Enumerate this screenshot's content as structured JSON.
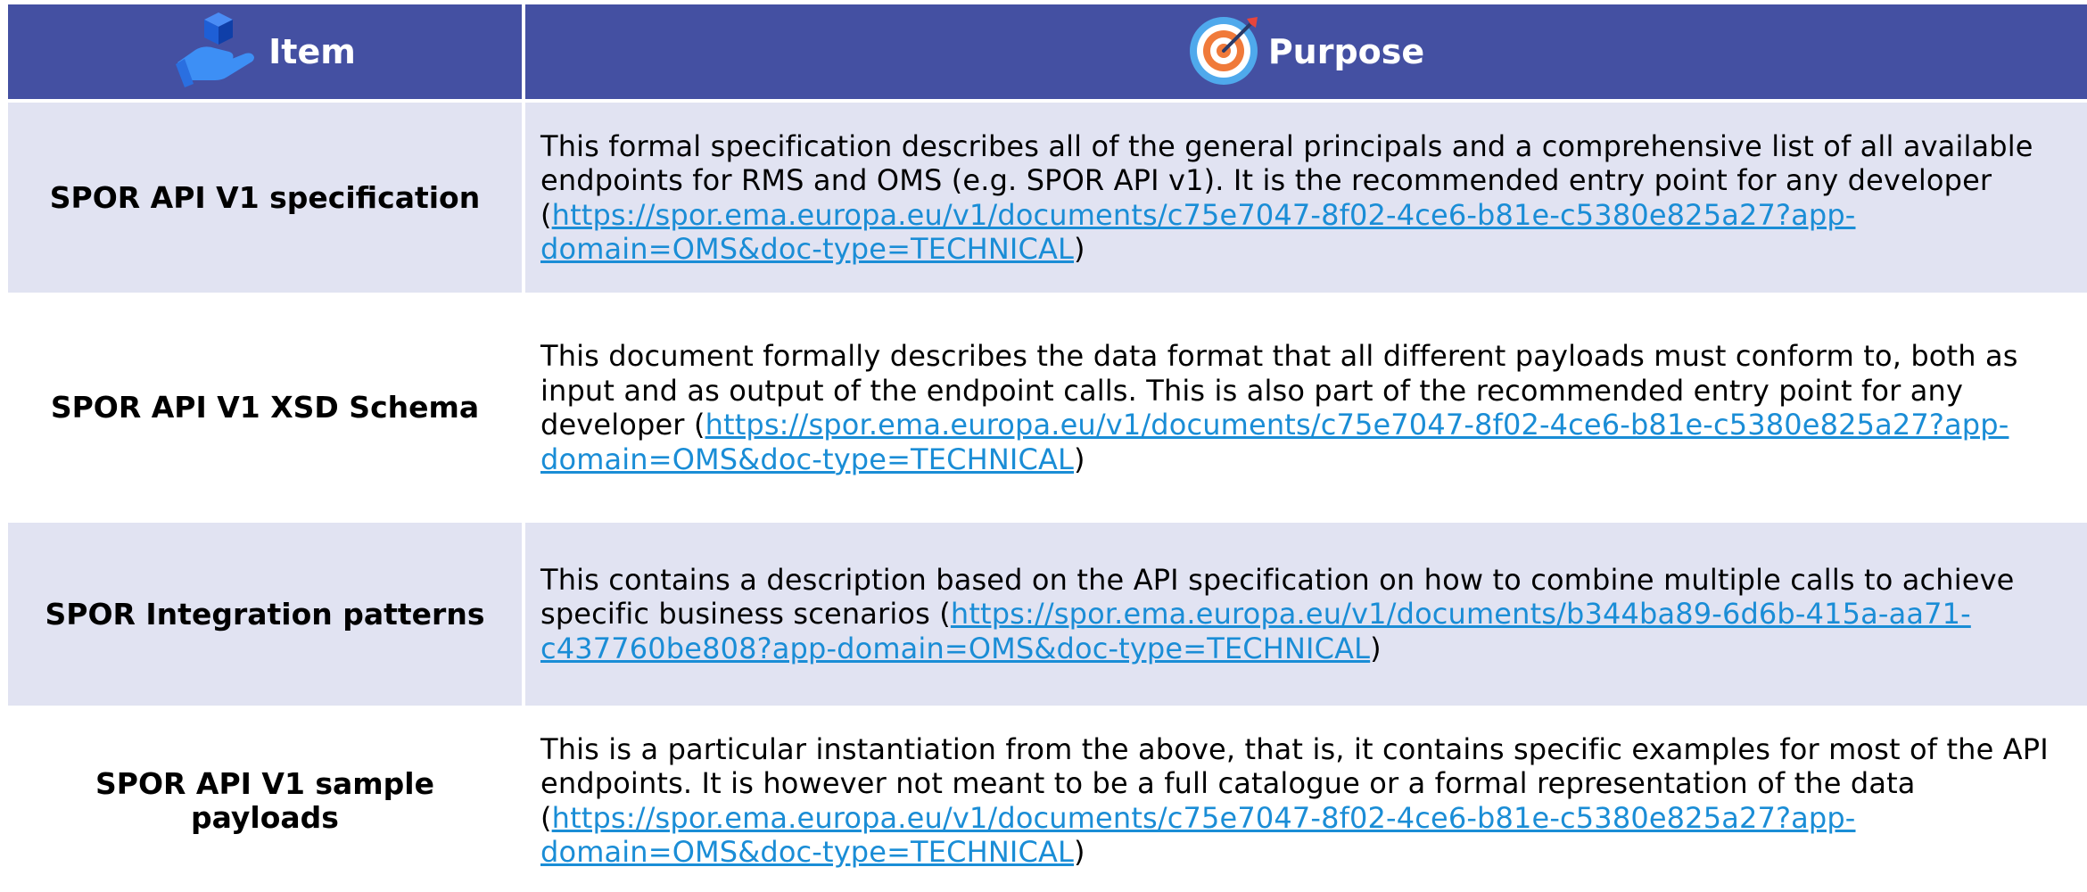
{
  "header": {
    "item_label": "Item",
    "purpose_label": "Purpose",
    "item_icon": "hand-holding-cube-icon",
    "purpose_icon": "target-dart-icon",
    "background_color": "#4450a2"
  },
  "rows": [
    {
      "item": "SPOR API V1 specification",
      "description": "This formal specification describes all of the general principals and a comprehensive list of all available endpoints for RMS and OMS (e.g. SPOR API v1). It is the recommended entry point for any developer",
      "link_open": "(",
      "link": "https://spor.ema.europa.eu/v1/documents/c75e7047-8f02-4ce6-b81e-c5380e825a27?app-domain=OMS&doc-type=TECHNICAL",
      "link_close": ")"
    },
    {
      "item": "SPOR API V1 XSD Schema",
      "description": "This document formally describes the data format that all different payloads must conform to, both as input and as output of the endpoint calls. This is also part of the recommended entry point for any developer",
      "link_open": "(",
      "link": "https://spor.ema.europa.eu/v1/documents/c75e7047-8f02-4ce6-b81e-c5380e825a27?app-domain=OMS&doc-type=TECHNICAL",
      "link_close": ")"
    },
    {
      "item": "SPOR Integration patterns",
      "description": "This contains a description based on the API specification on how to combine multiple calls to achieve specific business scenarios",
      "link_open": "(",
      "link": "https://spor.ema.europa.eu/v1/documents/b344ba89-6d6b-415a-aa71-c437760be808?app-domain=OMS&doc-type=TECHNICAL",
      "link_close": ")"
    },
    {
      "item": "SPOR API V1 sample payloads",
      "description": "This is a particular instantiation from the above, that is, it contains specific examples for most of the API endpoints. It is however not meant to be a full catalogue or a formal representation of the data",
      "link_open": "(",
      "link": "https://spor.ema.europa.eu/v1/documents/c75e7047-8f02-4ce6-b81e-c5380e825a27?app-domain=OMS&doc-type=TECHNICAL",
      "link_close": ")"
    }
  ],
  "colors": {
    "row_shade": "#e1e3f2",
    "link": "#1a8dd6"
  }
}
